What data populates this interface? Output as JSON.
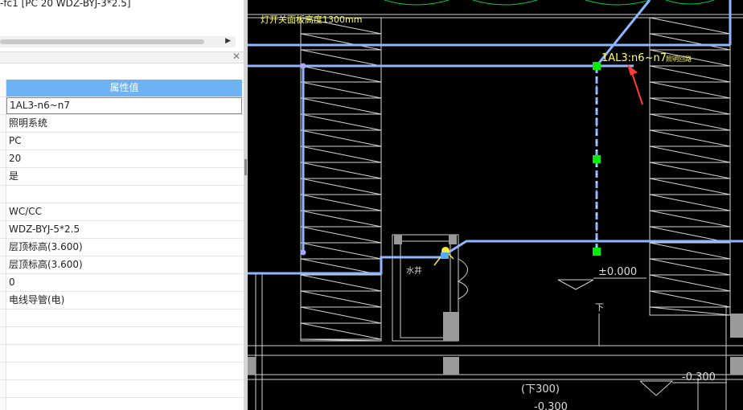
{
  "top_panel": {
    "header_text": "-fc1 [PC 20 WDZ-BYJ-3*2.5]",
    "second_line": "— —"
  },
  "property_panel": {
    "column_header": "属性值",
    "rows": [
      "1AL3-n6~n7",
      "照明系统",
      "PC",
      "20",
      "是",
      "",
      "WC/CC",
      "WDZ-BYJ-5*2.5",
      "层顶标高(3.600)",
      "层顶标高(3.600)",
      "0",
      "电线导管(电)",
      "",
      "",
      "",
      "",
      "",
      ""
    ]
  },
  "cad": {
    "annotation_height": "灯开关面板高度1300mm",
    "circuit_label": "1AL3:n6~n7",
    "circuit_label_suffix": "照明回路",
    "level_zero": "±0.000",
    "shaft_label": "水井",
    "down_label": "下",
    "level_minus": "-0.300",
    "level_minus2": "-0.300",
    "thickness_label": "(下300)",
    "colors": {
      "background": "#000000",
      "pipe": "#8fb6ff",
      "wall": "#cfcfcf",
      "node": "#00ff00",
      "annotation": "#ffff66",
      "arrow": "#ff3b3b"
    }
  }
}
